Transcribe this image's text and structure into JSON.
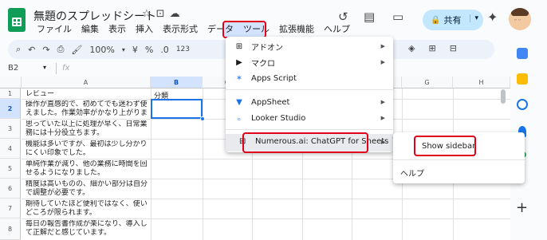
{
  "doc": {
    "title": "無題のスプレッドシート"
  },
  "menubar": [
    "ファイル",
    "編集",
    "表示",
    "挿入",
    "表示形式",
    "データ",
    "ツール",
    "拡張機能",
    "ヘルプ"
  ],
  "share": {
    "label": "共有"
  },
  "toolbar": {
    "zoom": "100%",
    "currency": "¥",
    "percent": "%",
    "decimal": ".0",
    "number": "123"
  },
  "namebox": {
    "cell": "B2",
    "fx": "fx"
  },
  "columns": [
    "A",
    "B",
    "C",
    "D",
    "E",
    "F",
    "G",
    "H"
  ],
  "rows": [
    {
      "num": "1",
      "a": "レビュー",
      "b": "分類"
    },
    {
      "num": "2",
      "a": "操作が直感的で、初めてでも迷わず使えました。作業効率がかなり上がります。",
      "b": ""
    },
    {
      "num": "3",
      "a": "思っていた以上に処理が早く、日常業務には十分役立ちます。",
      "b": ""
    },
    {
      "num": "4",
      "a": "機能は多いですが、最初は少し分かりにくい印象でした。",
      "b": ""
    },
    {
      "num": "5",
      "a": "単純作業が減り、他の業務に時間を回せるようになりました。",
      "b": ""
    },
    {
      "num": "6",
      "a": "精度は高いものの、細かい部分は自分で調整が必要です。",
      "b": ""
    },
    {
      "num": "7",
      "a": "期待していたほど便利ではなく、使いどころが限られます。",
      "b": ""
    },
    {
      "num": "8",
      "a": "毎日の報告書作成が楽になり、導入して正解だと感じています。",
      "b": ""
    }
  ],
  "dropdown": {
    "addons": "アドオン",
    "macro": "マクロ",
    "apps_script": "Apps Script",
    "appsheet": "AppSheet",
    "looker": "Looker Studio",
    "numerous": "Numerous.ai: ChatGPT for Sheets ™"
  },
  "submenu": {
    "show_sidebar": "Show sidebar",
    "help": "ヘルプ"
  },
  "colors": {
    "highlight_red": "#e0001a",
    "accent_blue": "#1a73e8",
    "sheets_green": "#0f9d58"
  }
}
